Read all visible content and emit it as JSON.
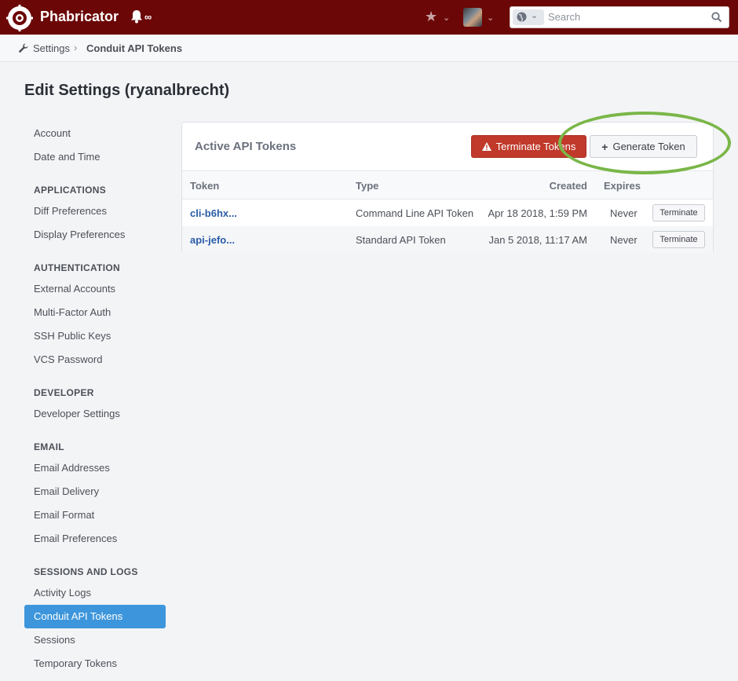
{
  "header": {
    "brand": "Phabricator",
    "notification_count": "∞",
    "search_placeholder": "Search"
  },
  "breadcrumb": {
    "root": "Settings",
    "separator": "›",
    "current": "Conduit API Tokens"
  },
  "page_title": "Edit Settings (ryanalbrecht)",
  "sidebar": {
    "items": [
      {
        "label": "Account"
      },
      {
        "label": "Date and Time"
      }
    ],
    "sections": [
      {
        "header": "APPLICATIONS",
        "items": [
          "Diff Preferences",
          "Display Preferences"
        ]
      },
      {
        "header": "AUTHENTICATION",
        "items": [
          "External Accounts",
          "Multi-Factor Auth",
          "SSH Public Keys",
          "VCS Password"
        ]
      },
      {
        "header": "DEVELOPER",
        "items": [
          "Developer Settings"
        ]
      },
      {
        "header": "EMAIL",
        "items": [
          "Email Addresses",
          "Email Delivery",
          "Email Format",
          "Email Preferences"
        ]
      },
      {
        "header": "SESSIONS AND LOGS",
        "items": [
          "Activity Logs",
          "Conduit API Tokens",
          "Sessions",
          "Temporary Tokens"
        ]
      }
    ],
    "active": "Conduit API Tokens"
  },
  "panel": {
    "title": "Active API Tokens",
    "terminate_all_label": "Terminate Tokens",
    "generate_label": "Generate Token",
    "columns": {
      "token": "Token",
      "type": "Type",
      "created": "Created",
      "expires": "Expires"
    },
    "rows": [
      {
        "token": "cli-b6hx...",
        "type": "Command Line API Token",
        "created": "Apr 18 2018, 1:59 PM",
        "expires": "Never",
        "action": "Terminate"
      },
      {
        "token": "api-jefo...",
        "type": "Standard API Token",
        "created": "Jan 5 2018, 11:17 AM",
        "expires": "Never",
        "action": "Terminate"
      }
    ]
  },
  "colors": {
    "topbar": "#6c0707",
    "active_nav": "#3d96db",
    "danger_button": "#c0392b",
    "highlight_ring": "#7ab648",
    "link": "#2a5da8"
  }
}
